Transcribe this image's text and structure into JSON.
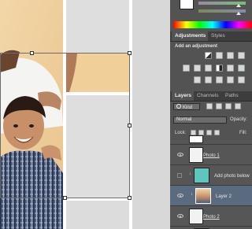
{
  "adjustments_panel": {
    "tabs": [
      "Adjustments",
      "Styles"
    ],
    "add_label": "Add an adjustment"
  },
  "layers_panel": {
    "tabs": [
      "Layers",
      "Channels",
      "Paths"
    ],
    "filter_kind": "Kind",
    "blend_mode": "Normal",
    "opacity_label": "Opacity:",
    "lock_label": "Lock:",
    "fill_label": "Fill:",
    "layers": [
      {
        "name": "Photo 1"
      },
      {
        "name": "Add photo below"
      },
      {
        "name": "Layer 2"
      },
      {
        "name": "Photo 2"
      }
    ]
  },
  "colors": {
    "panel_bg": "#535353",
    "selected_layer": "#5a6b80",
    "accent_teal": "#5fc6bf"
  }
}
